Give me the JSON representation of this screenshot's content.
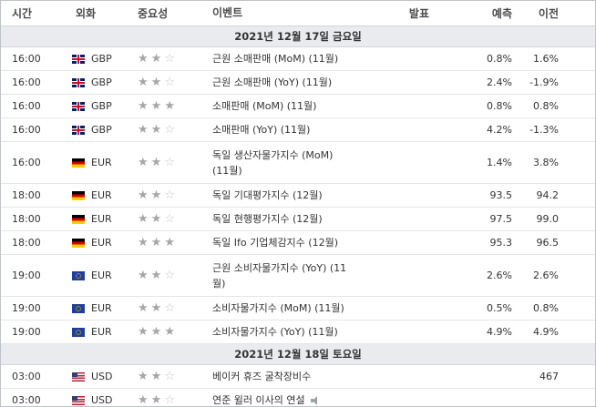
{
  "header": {
    "time": "시간",
    "currency": "외화",
    "importance": "중요성",
    "event": "이벤트",
    "actual": "발표",
    "forecast": "예측",
    "previous": "이전"
  },
  "groups": [
    {
      "date": "2021년 12월 17일 금요일",
      "rows": [
        {
          "time": "16:00",
          "flag": "gbp",
          "currency": "GBP",
          "stars": 2,
          "event_line1": "근원 소매판매 (MoM) (11월)",
          "event_line2": "",
          "actual": "",
          "forecast": "0.8%",
          "previous": "1.6%"
        },
        {
          "time": "16:00",
          "flag": "gbp",
          "currency": "GBP",
          "stars": 2,
          "event_line1": "근원 소매판매 (YoY) (11월)",
          "event_line2": "",
          "actual": "",
          "forecast": "2.4%",
          "previous": "-1.9%"
        },
        {
          "time": "16:00",
          "flag": "gbp",
          "currency": "GBP",
          "stars": 3,
          "event_line1": "소매판매 (MoM) (11월)",
          "event_line2": "",
          "actual": "",
          "forecast": "0.8%",
          "previous": "0.8%"
        },
        {
          "time": "16:00",
          "flag": "gbp",
          "currency": "GBP",
          "stars": 2,
          "event_line1": "소매판매 (YoY) (11월)",
          "event_line2": "",
          "actual": "",
          "forecast": "4.2%",
          "previous": "-1.3%"
        },
        {
          "time": "16:00",
          "flag": "eur-de",
          "currency": "EUR",
          "stars": 2,
          "event_line1": "독일 생산자물가지수 (MoM)",
          "event_line2": "(11월)",
          "actual": "",
          "forecast": "1.4%",
          "previous": "3.8%"
        },
        {
          "time": "18:00",
          "flag": "eur-de",
          "currency": "EUR",
          "stars": 2,
          "event_line1": "독일 기대평가지수 (12월)",
          "event_line2": "",
          "actual": "",
          "forecast": "93.5",
          "previous": "94.2"
        },
        {
          "time": "18:00",
          "flag": "eur-de",
          "currency": "EUR",
          "stars": 2,
          "event_line1": "독일 현행평가지수 (12월)",
          "event_line2": "",
          "actual": "",
          "forecast": "97.5",
          "previous": "99.0"
        },
        {
          "time": "18:00",
          "flag": "eur-de",
          "currency": "EUR",
          "stars": 3,
          "event_line1": "독일 Ifo 기업체감지수 (12월)",
          "event_line2": "",
          "actual": "",
          "forecast": "95.3",
          "previous": "96.5"
        },
        {
          "time": "19:00",
          "flag": "eur-eu",
          "currency": "EUR",
          "stars": 2,
          "event_line1": "근원 소비자물가지수 (YoY) (11",
          "event_line2": "월)",
          "actual": "",
          "forecast": "2.6%",
          "previous": "2.6%"
        },
        {
          "time": "19:00",
          "flag": "eur-eu",
          "currency": "EUR",
          "stars": 2,
          "event_line1": "소비자물가지수 (MoM) (11월)",
          "event_line2": "",
          "actual": "",
          "forecast": "0.5%",
          "previous": "0.8%"
        },
        {
          "time": "19:00",
          "flag": "eur-eu",
          "currency": "EUR",
          "stars": 3,
          "event_line1": "소비자물가지수 (YoY) (11월)",
          "event_line2": "",
          "actual": "",
          "forecast": "4.9%",
          "previous": "4.9%"
        }
      ]
    },
    {
      "date": "2021년 12월 18일 토요일",
      "rows": [
        {
          "time": "03:00",
          "flag": "usd",
          "currency": "USD",
          "stars": 2,
          "event_line1": "베이커 휴즈 굴착장비수",
          "event_line2": "",
          "actual": "",
          "forecast": "",
          "previous": "467"
        },
        {
          "time": "03:00",
          "flag": "usd",
          "currency": "USD",
          "stars": 2,
          "event_line1": "연준 윌러 이사의 연설",
          "event_line2": "",
          "speech": true,
          "actual": "",
          "forecast": "",
          "previous": ""
        }
      ]
    }
  ],
  "colors": {
    "header_bg": "#ffffff",
    "date_row_bg": "#e9ebee",
    "star_on": "#a6a6a6",
    "star_off": "#c6c6c6",
    "border": "#bfc3c8"
  },
  "icons": {
    "speech": "speaker-icon",
    "star": "star-icon"
  }
}
